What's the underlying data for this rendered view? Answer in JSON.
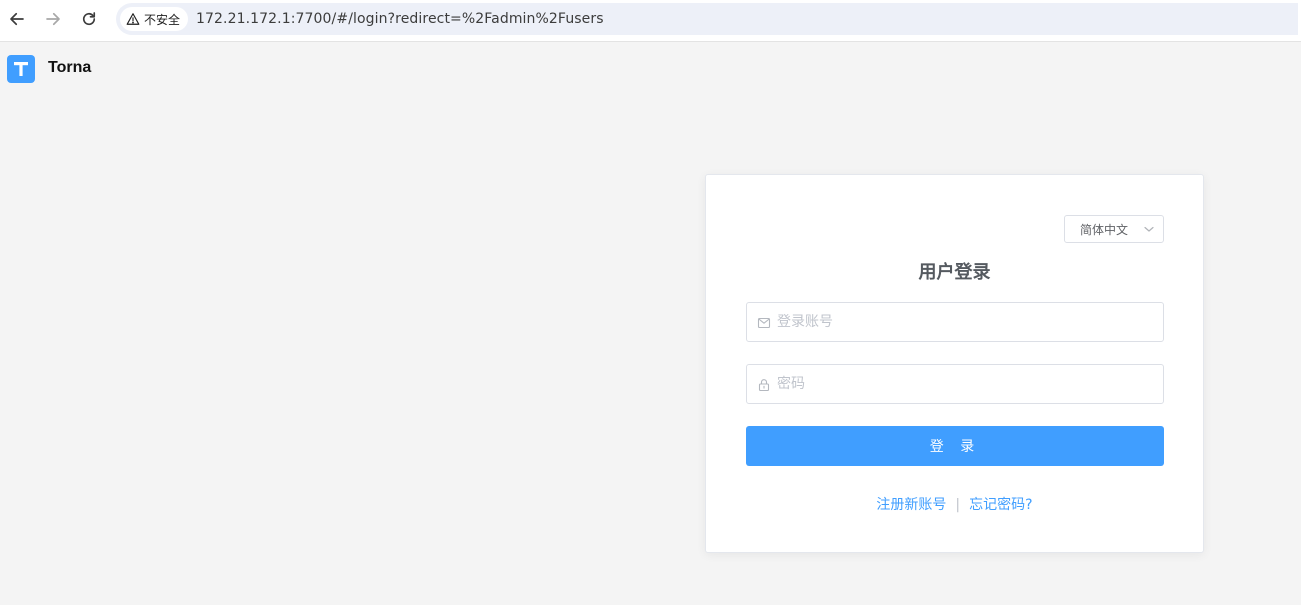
{
  "browser": {
    "security_label": "不安全",
    "url": "172.21.172.1:7700/#/login?redirect=%2Fadmin%2Fusers"
  },
  "app": {
    "logo_letter": "T",
    "name": "Torna"
  },
  "login": {
    "language": "简体中文",
    "title": "用户登录",
    "username_placeholder": "登录账号",
    "username_value": "",
    "password_placeholder": "密码",
    "password_value": "",
    "submit_label": "登 录",
    "register_link": "注册新账号",
    "separator": "|",
    "forgot_link": "忘记密码?"
  },
  "colors": {
    "primary": "#409eff",
    "background": "#f4f4f4"
  }
}
